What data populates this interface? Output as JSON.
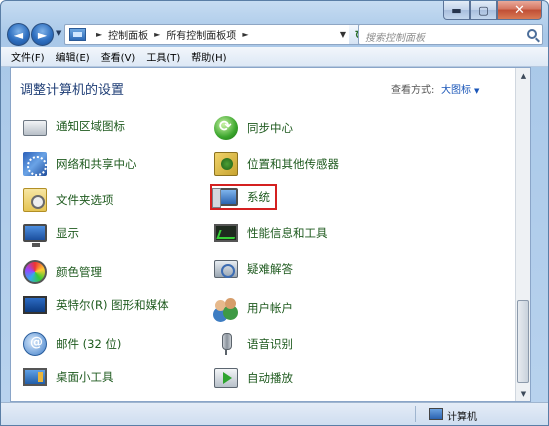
{
  "window": {
    "caption_buttons": {
      "minimize": "▬",
      "maximize": "▢",
      "close": "✕"
    }
  },
  "nav": {
    "back": "◄",
    "forward": "►",
    "dropdown": "▼",
    "breadcrumbs": [
      "控制面板",
      "所有控制面板项"
    ],
    "separator": "►",
    "address_dropdown": "▼",
    "refresh": "↻",
    "search_placeholder": "搜索控制面板"
  },
  "menu": {
    "items": [
      "文件(F)",
      "编辑(E)",
      "查看(V)",
      "工具(T)",
      "帮助(H)"
    ]
  },
  "content": {
    "heading": "调整计算机的设置",
    "view_by_label": "查看方式:",
    "view_by_value": "大图标",
    "view_by_arrow": "▼",
    "left_column": [
      {
        "label": "通知区域图标",
        "icon": "notification-area-icon"
      },
      {
        "label": "网络和共享中心",
        "icon": "network-center-icon"
      },
      {
        "label": "文件夹选项",
        "icon": "folder-options-icon"
      },
      {
        "label": "显示",
        "icon": "display-icon"
      },
      {
        "label": "颜色管理",
        "icon": "color-management-icon"
      },
      {
        "label": "英特尔(R) 图形和媒体",
        "icon": "intel-graphics-icon"
      },
      {
        "label": "邮件 (32 位)",
        "icon": "mail-icon"
      },
      {
        "label": "桌面小工具",
        "icon": "desktop-gadgets-icon"
      }
    ],
    "right_column": [
      {
        "label": "同步中心",
        "icon": "sync-center-icon"
      },
      {
        "label": "位置和其他传感器",
        "icon": "location-sensors-icon"
      },
      {
        "label": "系统",
        "icon": "system-icon"
      },
      {
        "label": "性能信息和工具",
        "icon": "performance-icon"
      },
      {
        "label": "疑难解答",
        "icon": "troubleshooting-icon"
      },
      {
        "label": "用户帐户",
        "icon": "user-accounts-icon"
      },
      {
        "label": "语音识别",
        "icon": "speech-recognition-icon"
      },
      {
        "label": "自动播放",
        "icon": "autoplay-icon"
      }
    ],
    "highlight_color": "#d42020"
  },
  "scrollbar": {
    "up": "▲",
    "down": "▼"
  },
  "status": {
    "text": "计算机"
  }
}
